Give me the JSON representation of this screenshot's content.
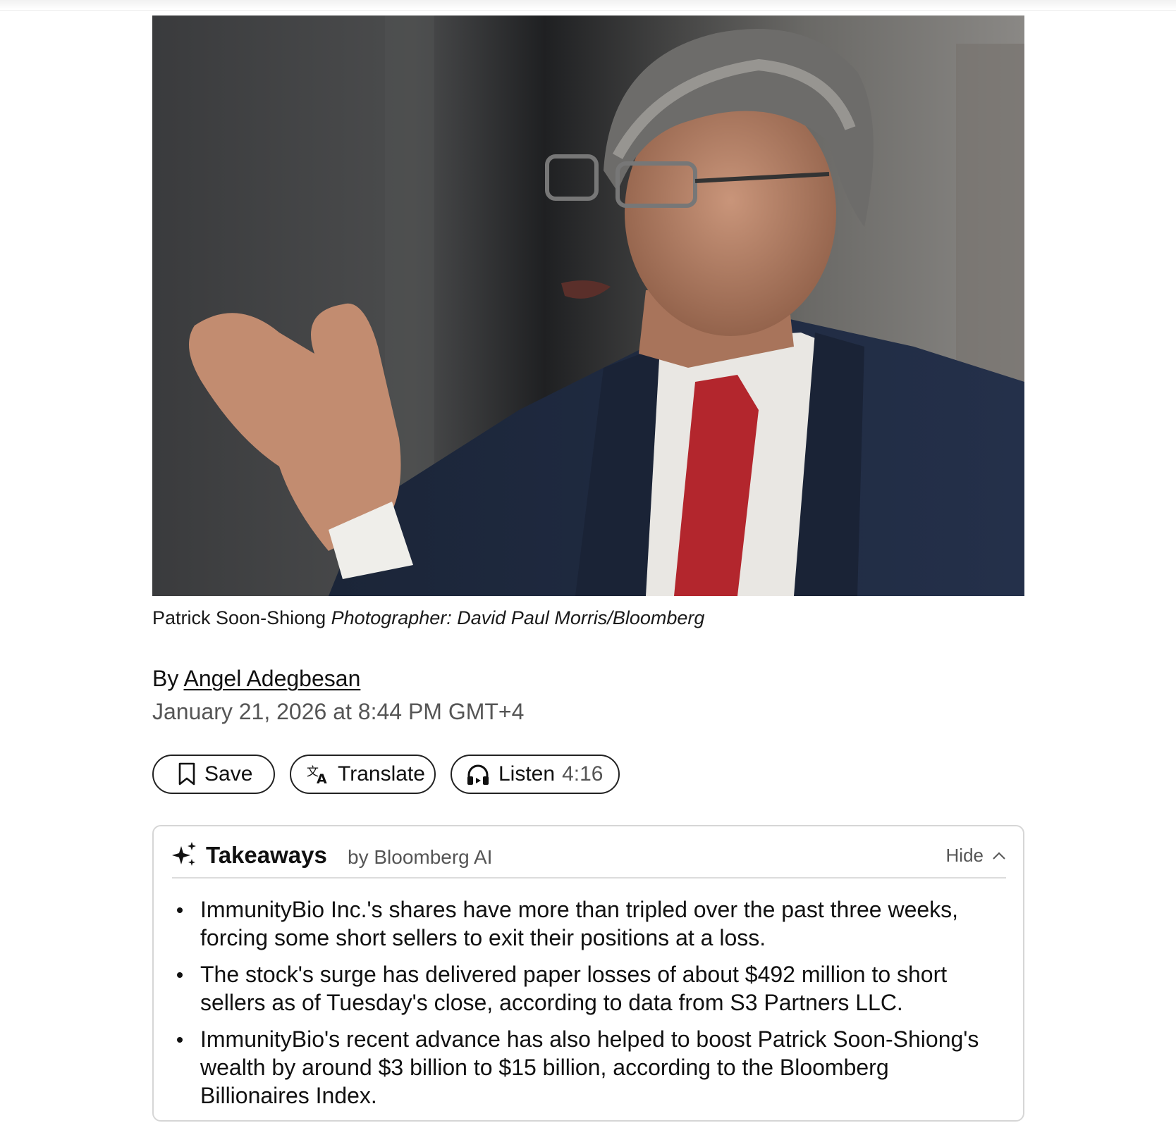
{
  "photo": {
    "caption_subject": "Patrick Soon-Shiong",
    "caption_credit": "Photographer: David Paul Morris/Bloomberg"
  },
  "byline": {
    "prefix": "By",
    "author": "Angel Adegbesan",
    "date": "January 21, 2026 at 8:44 PM GMT+4"
  },
  "actions": {
    "save_label": "Save",
    "translate_label": "Translate",
    "listen_label": "Listen",
    "listen_duration": "4:16",
    "save_icon": "bookmark-icon",
    "translate_icon": "translate-icon",
    "listen_icon": "headphones-icon"
  },
  "takeaways": {
    "title": "Takeaways",
    "by": "by Bloomberg AI",
    "hide_label": "Hide",
    "title_icon": "sparkle-icon",
    "hide_icon": "chevron-up-icon",
    "items": [
      "ImmunityBio Inc.'s shares have more than tripled over the past three weeks, forcing some short sellers to exit their positions at a loss.",
      "The stock's surge has delivered paper losses of about $492 million to short sellers as of Tuesday's close, according to data from S3 Partners LLC.",
      "ImmunityBio's recent advance has also helped to boost Patrick Soon-Shiong's wealth by around $3 billion to $15 billion, according to the Bloomberg Billionaires Index."
    ]
  }
}
